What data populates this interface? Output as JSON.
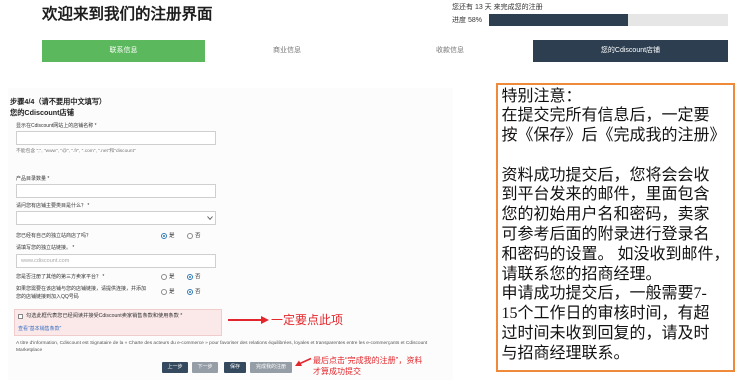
{
  "colors": {
    "tab_done": "#5cb85c",
    "tab_active": "#2c3e50",
    "progress_fill": "#2c3e50",
    "button_primary": "#34495e",
    "button_secondary": "#959ea6",
    "notice_border": "#ee8a3a",
    "annotation_red": "#e3262b",
    "radio_selected": "#337ab7",
    "link": "#3b6fc2"
  },
  "icons": {
    "select_arrow": "chevron-down-icon",
    "callout_arrow": "arrow-icon"
  },
  "header": {
    "title": "欢迎来到我们的注册界面",
    "days_notice": "您还有 13 天 来完成您的注册",
    "progress_label": "进度 58%",
    "progress_percent": 58
  },
  "tabs": [
    "联系信息",
    "商业信息",
    "收款信息",
    "您的Cdiscount店铺"
  ],
  "form": {
    "step_title": "步骤4/4（请不要用中文填写）",
    "section_title": "您的Cdiscount店铺",
    "shop_name": {
      "label": "显示在Cdiscount网站上的店铺名称 *",
      "hint": "不能包含 \";\", \"www\", \"@\", \".fr\", \".com\", \".net\"和\"discount\""
    },
    "catalog_size": {
      "label": "产品目录数量 *"
    },
    "main_category": {
      "label": "请问您有店铺主要类目是什么？ *"
    },
    "has_own_site": {
      "label": "您已经有自己的独立站商店了吗？",
      "options": [
        "是",
        "否"
      ],
      "selected_index": 0
    },
    "site_url": {
      "label": "请填写您的独立站链接。 *",
      "placeholder": "www.cdiscount.com"
    },
    "other_platforms": {
      "label": "您是否注册了其他的第三方卖家平台？ *",
      "options": [
        "是",
        "否"
      ],
      "selected_index": 1
    },
    "shop_link": {
      "label_lines": [
        "如果您需要在该店铺与您的店铺链接，请提供连接，并添加",
        "您的店铺链接到加入QQ号码"
      ],
      "options": [
        "是",
        "否"
      ],
      "selected_index": 1
    },
    "terms": {
      "label": "勾选此框代表您已经阅读并接受Cdiscount卖家销售条款和使用条款 *",
      "checked": false,
      "link": "查看“基本销售条款”"
    },
    "charter_note": "A titre d'information, Cdiscount est Signataire de la « Charte des acteurs du e-commerce » pour favoriser des relations équilibrées, loyales et transparentes entre les e-commerçants et Cdiscount Marketplace",
    "buttons": {
      "previous": "上一步",
      "next": "下一步",
      "save": "保存",
      "finish": "完成我的注册"
    }
  },
  "annotations": {
    "terms_callout": "一定要点此项",
    "finish_callout": [
      "最后点击“完成我的注册”，资料",
      "才算成功提交"
    ]
  },
  "notice": {
    "title": "特别注意：",
    "paragraphs": [
      [
        "在提交完所有信息后，一定要",
        "按《保存》后《完成我的注册》"
      ],
      [
        "资料成功提交后，您将会会收",
        "到平台发来的邮件，里面包含",
        "您的初始用户名和密码，卖家",
        "可参考后面的附录进行登录名",
        "和密码的设置。 如没收到邮件，",
        "请联系您的招商经理。"
      ],
      [
        "申请成功提交后，一般需要7-",
        "15个工作日的审核时间，有超",
        "过时间未收到回复的，请及时",
        "与招商经理联系。"
      ]
    ]
  }
}
